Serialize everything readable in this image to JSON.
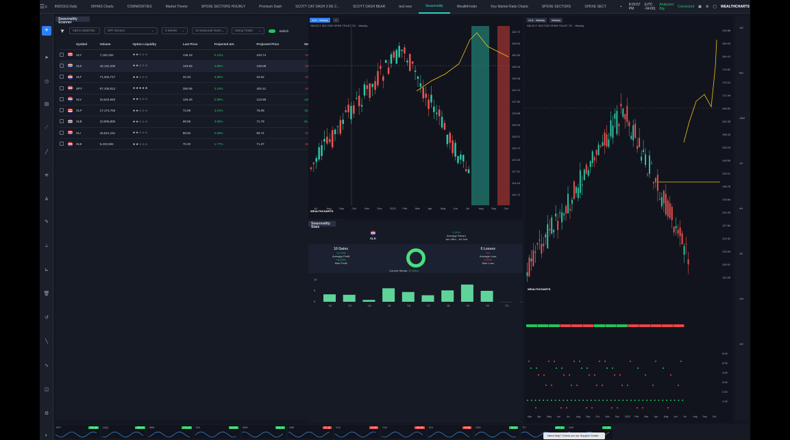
{
  "topbar": {
    "tabs": [
      "INDICES Daily",
      "SHHAS Charts",
      "COMMODITIES",
      "Market Theme",
      "SPDXE SECTORS HOURLY",
      "Premium Dash",
      "SCOTT CAT DASH 3 DE 2...",
      "SCOTT DASH BEAR",
      "test new",
      "Seasonality",
      "WealthFinder",
      "Key Market Ratio Charts",
      "SPDXE SECTORS",
      "SPDXE SECT"
    ],
    "active_tab": "Seasonality",
    "time": "8:20:57 PM",
    "timezone": "(UTC -04:00)",
    "status1": "Analyzed Big",
    "status2": "Connected",
    "brand": "WEALTHCHARTS"
  },
  "scanner": {
    "title": "Seasonality Scanner",
    "search_placeholder": "Add to Watchlist",
    "filters": [
      "SPF Sectors",
      "4 Weeks",
      "10 Seasonal Years",
      "Swing Trader"
    ],
    "toggle_label": "Bullish",
    "columns": [
      "Symbol",
      "Volume",
      "Option Liquidity",
      "Last Price",
      "Projected Δ%",
      "Projected Price",
      "WealthScore"
    ],
    "rows": [
      {
        "symbol": "XLY",
        "volume": "7,193,182",
        "stars": "★★☆☆☆",
        "last": "146.19",
        "pct": "5.10%",
        "proj": "153.74",
        "score": "-198.00"
      },
      {
        "symbol": "XLK",
        "volume": "18,122,200",
        "stars": "★★☆☆☆",
        "last": "133.93",
        "pct": "3.88%",
        "proj": "139.08",
        "score": "-196.00"
      },
      {
        "symbol": "XLF",
        "volume": "71,204,717",
        "stars": "★★☆☆☆",
        "last": "32.34",
        "pct": "3.98%",
        "proj": "33.62",
        "score": "-188.00"
      },
      {
        "symbol": "SPY",
        "volume": "87,105,912",
        "stars": "★★★★★",
        "last": "390.08",
        "pct": "3.18%",
        "proj": "402.41",
        "score": "-188.00"
      },
      {
        "symbol": "XLV",
        "volume": "10,642,940",
        "stars": "★★☆☆☆",
        "last": "120.29",
        "pct": "2.98%",
        "proj": "123.88",
        "score": "136.00"
      },
      {
        "symbol": "XLP",
        "volume": "17,174,706",
        "stars": "★★☆☆☆",
        "last": "72.88",
        "pct": "3.23%",
        "proj": "75.08",
        "score": "181.00"
      },
      {
        "symbol": "XLB",
        "volume": "10,006,806",
        "stars": "★★☆☆☆",
        "last": "69.06",
        "pct": "3.59%",
        "proj": "71.79",
        "score": "91.00"
      },
      {
        "symbol": "XLI",
        "volume": "16,621,151",
        "stars": "★★☆☆☆",
        "last": "88.92",
        "pct": "2.08%",
        "proj": "90.74",
        "score": "-196.00"
      },
      {
        "symbol": "XLE",
        "volume": "5,232,594",
        "stars": "★★☆☆☆",
        "last": "70.40",
        "pct": "1.77%",
        "proj": "71.37",
        "score": "-196.00"
      }
    ]
  },
  "chartA": {
    "tabs": [
      "XLK - Weekly",
      "+"
    ],
    "subtitle": "SELECT SECTOR SPDR TRUST TE...   Weekly",
    "price_labels": [
      "162.72",
      "158.93",
      "152.54",
      "148.40",
      "146.48",
      "141.21",
      "137.82",
      "133.96",
      "130.94",
      "128.11",
      "125.72",
      "121.54",
      "117.31",
      "114.54",
      "110.72"
    ],
    "months": [
      "Jul",
      "Aug",
      "Sep",
      "Oct",
      "Nov",
      "Dec",
      "2022",
      "Feb",
      "Mar",
      "Apr",
      "May",
      "Jun",
      "Jul",
      "Aug",
      "Sep",
      "Oct"
    ],
    "brand": "WEALTHCHARTS"
  },
  "stats": {
    "title": "Seasonality Stats",
    "symbol": "XLK",
    "avg_return": "4.22%",
    "avg_return_label": "Average Return",
    "date_range": "Jun 28rd - Jul 2nd",
    "gains": "10 Gains",
    "gain_pct": "+4.22%",
    "avg_profit_label": "Average Profit",
    "max_profit": "+8.02%",
    "max_profit_label": "Max Profit",
    "losses": "0 Losses",
    "loss_pct": "0%",
    "avg_loss_label": "Average Loss",
    "max_loss": "0.00%",
    "max_loss_label": "Max Loss",
    "streak_label": "Current Streak:",
    "streak_value": "10 Wins",
    "bars_y": [
      "10",
      "5",
      "0"
    ],
    "bar_years": [
      "'12",
      "'13",
      "'14",
      "'15",
      "'16",
      "'17",
      "'18",
      "'19",
      "'20",
      "'21",
      "'22"
    ]
  },
  "chart_data": {
    "type": "bar",
    "categories": [
      "'12",
      "'13",
      "'14",
      "'15",
      "'16",
      "'17",
      "'18",
      "'19",
      "'20",
      "'21",
      "'22"
    ],
    "values": [
      3.2,
      3.0,
      0.8,
      5.8,
      4.2,
      2.8,
      4.9,
      7.4,
      4.7,
      0.0,
      0.0
    ]
  },
  "chartB": {
    "tabs": [
      "XLK - Weekly",
      "Weekly"
    ],
    "subtitle": "SELECT SECTOR SPDR TRUST TE...   Weekly",
    "price_labels": [
      "193.88",
      "189.00",
      "184.41",
      "179.81",
      "175.31",
      "171.99",
      "168.52",
      "162.35",
      "158.40",
      "153.19",
      "148.59",
      "143.11",
      "138.78",
      "134.84",
      "131.00",
      "127.60",
      "124.32",
      "120.64",
      "116.51",
      "112.85"
    ],
    "lower_labels": [
      "6.00",
      "5.00",
      "4.00",
      "3.00",
      "2.00",
      "1.00"
    ],
    "months": [
      "Mar",
      "Apr",
      "May",
      "Jun",
      "Jul",
      "Aug",
      "Sep",
      "Oct",
      "Nov",
      "Dec",
      "2022",
      "Feb",
      "Mar",
      "Apr",
      "May",
      "Jun",
      "Jul",
      "Aug",
      "Sep",
      "Oct"
    ],
    "brand": "WEALTHCHARTS"
  },
  "rightbar": [
    "1M",
    "5M",
    "15M",
    "1H",
    "4H",
    "1D",
    "1W",
    "1M"
  ],
  "bottom": [
    {
      "sym": "SPY",
      "price": "390.68",
      "color": "#22c55e"
    },
    {
      "sym": "QQQ",
      "price": "288.50",
      "color": "#22c55e"
    },
    {
      "sym": "IWM",
      "price": "174.12",
      "color": "#22c55e"
    },
    {
      "sym": "DIA",
      "price": "311.81",
      "color": "#22c55e"
    },
    {
      "sym": "SMH",
      "price": "204.11",
      "color": "#22c55e"
    },
    {
      "sym": "XME",
      "price": "47.12",
      "color": "#ef4444"
    },
    {
      "sym": "VXX",
      "price": "22.90",
      "color": "#ef4444"
    },
    {
      "sym": "GLD",
      "price": "169.90",
      "color": "#ef4444"
    },
    {
      "sym": "SLV",
      "price": "19.48",
      "color": "#ef4444"
    },
    {
      "sym": "USO",
      "price": "75.32",
      "color": "#22c55e"
    },
    {
      "sym": "TLT",
      "price": "107.11",
      "color": "#22c55e"
    },
    {
      "sym": "UUP",
      "price": "27.20",
      "color": "#22c55e"
    }
  ],
  "toast": "Need help? Check out our Support Center"
}
